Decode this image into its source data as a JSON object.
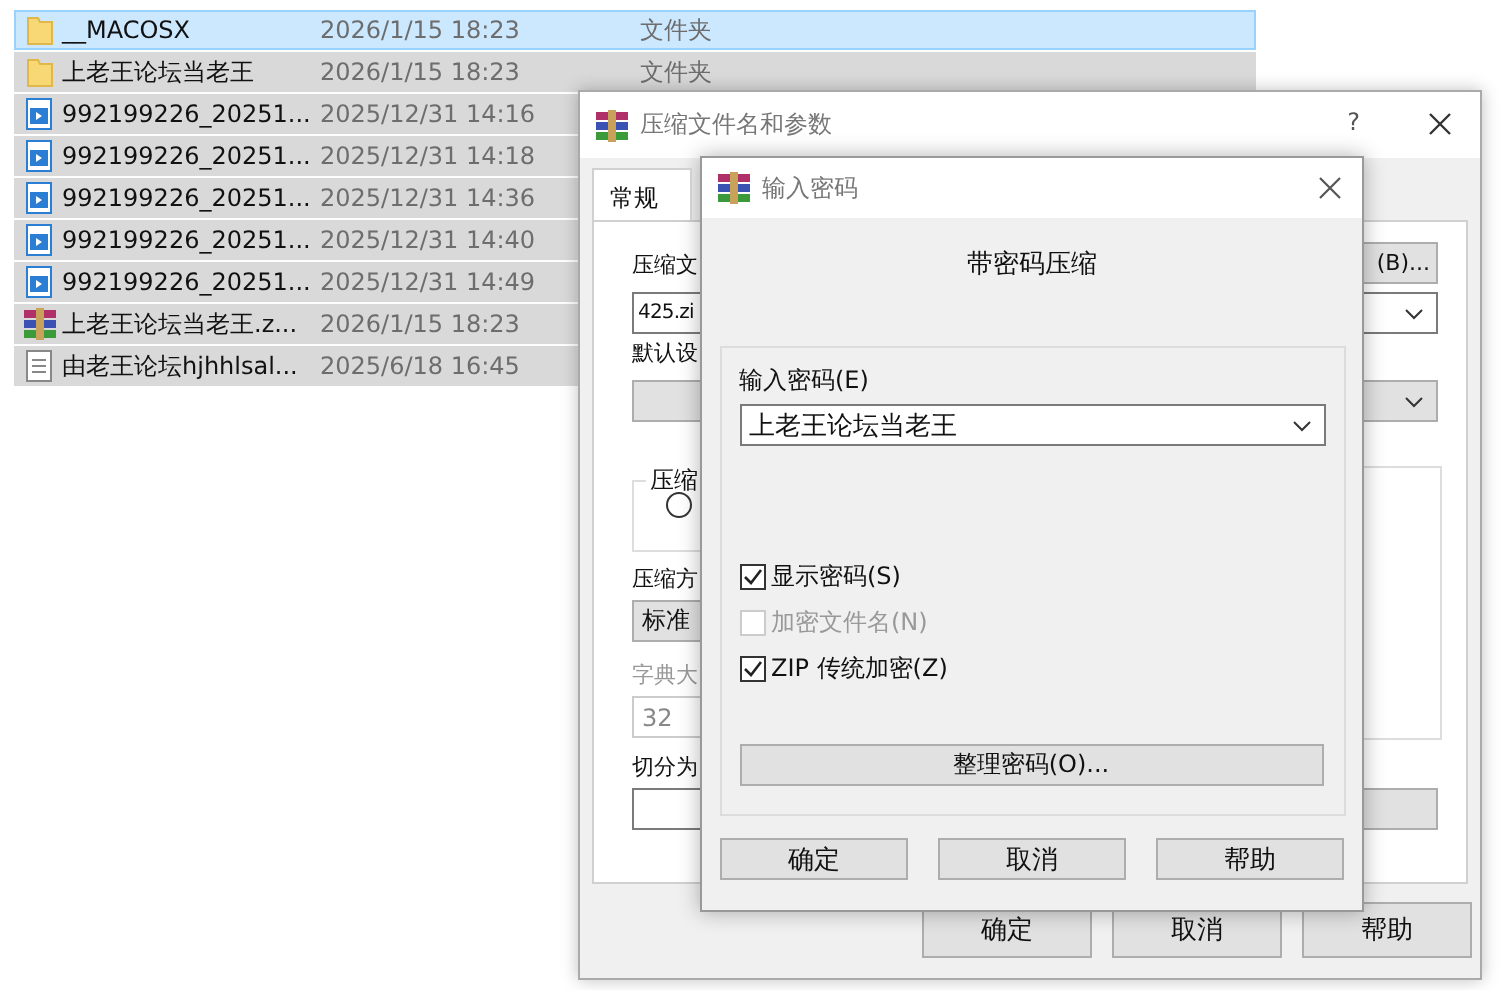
{
  "files": [
    {
      "kind": "folder",
      "name": "__MACOSX",
      "date": "2026/1/15 18:23",
      "type": "文件夹",
      "selected": true,
      "focused": true
    },
    {
      "kind": "folder",
      "name": "上老王论坛当老王",
      "date": "2026/1/15 18:23",
      "type": "文件夹",
      "selected": true,
      "focused": false
    },
    {
      "kind": "video",
      "name": "992199226_20251...",
      "date": "2025/12/31 14:16",
      "selected": true,
      "focused": false
    },
    {
      "kind": "video",
      "name": "992199226_20251...",
      "date": "2025/12/31 14:18",
      "selected": true,
      "focused": false
    },
    {
      "kind": "video",
      "name": "992199226_20251...",
      "date": "2025/12/31 14:36",
      "selected": true,
      "focused": false
    },
    {
      "kind": "video",
      "name": "992199226_20251...",
      "date": "2025/12/31 14:40",
      "selected": true,
      "focused": false
    },
    {
      "kind": "video",
      "name": "992199226_20251...",
      "date": "2025/12/31 14:49",
      "selected": true,
      "focused": false
    },
    {
      "kind": "archive",
      "name": "上老王论坛当老王.z...",
      "date": "2026/1/15 18:23",
      "selected": true,
      "focused": false
    },
    {
      "kind": "text",
      "name": "由老王论坛hjhhlsal...",
      "date": "2025/6/18 16:45",
      "selected": true,
      "focused": false
    }
  ],
  "archive_dialog": {
    "title": "压缩文件名和参数",
    "help": "?",
    "tabs": [
      {
        "label": "常规",
        "selected": true
      }
    ],
    "archive_name_label": "压缩文",
    "archive_name": "425.zi",
    "browse_button": "(B)...",
    "default_profile_label": "默认设",
    "format_group_label": "压缩",
    "format_option": {
      "checked": false
    },
    "method_label": "压缩方",
    "method": "标准",
    "dictionary_label": "字典大",
    "dictionary": "32",
    "split_label": "切分为",
    "buttons": [
      "确定",
      "取消",
      "帮助"
    ]
  },
  "password_dialog": {
    "title": "输入密码",
    "heading": "带密码压缩",
    "password_label": "输入密码(E)",
    "password": "上老王论坛当老王",
    "options": [
      {
        "label": "显示密码(S)",
        "checked": true,
        "disabled": false
      },
      {
        "label": "加密文件名(N)",
        "checked": false,
        "disabled": true
      },
      {
        "label": "ZIP 传统加密(Z)",
        "checked": true,
        "disabled": false
      }
    ],
    "organize_button": "整理密码(O)...",
    "buttons": [
      "确定",
      "取消",
      "帮助"
    ]
  }
}
